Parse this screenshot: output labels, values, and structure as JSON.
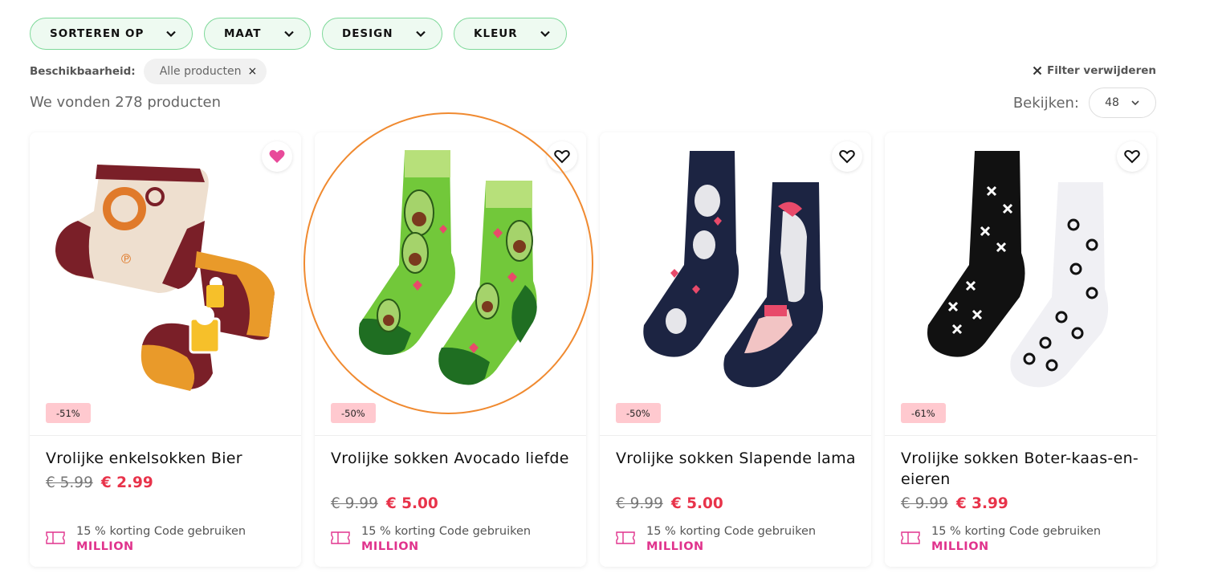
{
  "filters": [
    {
      "label": "SORTEREN OP"
    },
    {
      "label": "MAAT"
    },
    {
      "label": "DESIGN"
    },
    {
      "label": "KLEUR"
    }
  ],
  "availability": {
    "label": "Beschikbaarheid:",
    "chip": "Alle producten",
    "chip_close": "×"
  },
  "remove_filter": {
    "label": "Filter verwijderen"
  },
  "results_count": "We vonden 278 producten",
  "view": {
    "label": "Bekijken:",
    "value": "48"
  },
  "colors": {
    "filter_border": "#7fd99a",
    "sale_price": "#e8334a",
    "promo_code": "#e0348d",
    "badge_bg": "#ffc9cf",
    "highlight_circle": "#f08a30"
  },
  "products": [
    {
      "title": "Vrolijke enkelsokken Bier",
      "old_price": "€ 5.99",
      "new_price": "€ 2.99",
      "discount": "-51%",
      "favorited": true,
      "promo_text": "15 % korting Code gebruiken",
      "promo_code": "MILLION"
    },
    {
      "title": "Vrolijke sokken Avocado liefde",
      "old_price": "€ 9.99",
      "new_price": "€ 5.00",
      "discount": "-50%",
      "favorited": false,
      "promo_text": "15 % korting Code gebruiken",
      "promo_code": "MILLION"
    },
    {
      "title": "Vrolijke sokken Slapende lama",
      "old_price": "€ 9.99",
      "new_price": "€ 5.00",
      "discount": "-50%",
      "favorited": false,
      "promo_text": "15 % korting Code gebruiken",
      "promo_code": "MILLION"
    },
    {
      "title": "Vrolijke sokken Boter-kaas-en-eieren",
      "old_price": "€ 9.99",
      "new_price": "€ 3.99",
      "discount": "-61%",
      "favorited": false,
      "promo_text": "15 % korting Code gebruiken",
      "promo_code": "MILLION"
    }
  ]
}
